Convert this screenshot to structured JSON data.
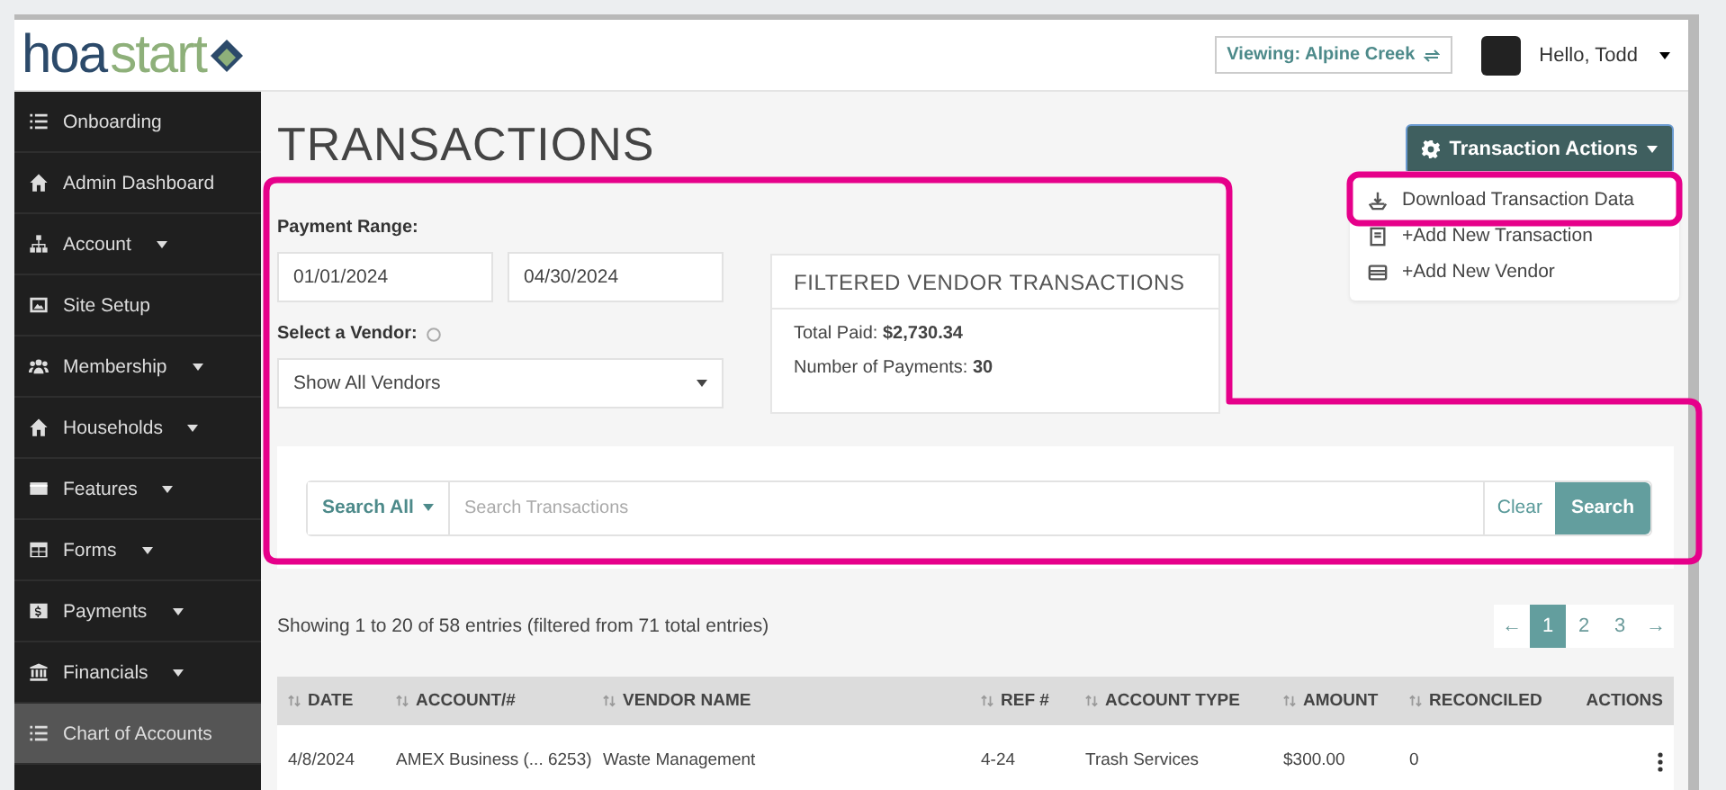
{
  "header": {
    "logo": [
      "hoa",
      "start"
    ],
    "viewing": "Viewing: Alpine Creek",
    "greeting": "Hello, Todd"
  },
  "sidebar": {
    "items": [
      {
        "label": "Onboarding",
        "has_menu": false,
        "selected": false
      },
      {
        "label": "Admin Dashboard",
        "has_menu": false,
        "selected": false
      },
      {
        "label": "Account",
        "has_menu": true,
        "selected": false
      },
      {
        "label": "Site Setup",
        "has_menu": false,
        "selected": false
      },
      {
        "label": "Membership",
        "has_menu": true,
        "selected": false
      },
      {
        "label": "Households",
        "has_menu": true,
        "selected": false
      },
      {
        "label": "Features",
        "has_menu": true,
        "selected": false
      },
      {
        "label": "Forms",
        "has_menu": true,
        "selected": false
      },
      {
        "label": "Payments",
        "has_menu": true,
        "selected": false
      },
      {
        "label": "Financials",
        "has_menu": true,
        "selected": false
      },
      {
        "label": "Chart of Accounts",
        "has_menu": false,
        "selected": true
      }
    ]
  },
  "page_title": "TRANSACTIONS",
  "actions_button": "Transaction Actions",
  "actions_menu": [
    {
      "label": "Download Transaction Data",
      "highlighted": true
    },
    {
      "label": "+Add New Transaction",
      "highlighted": false
    },
    {
      "label": "+Add New Vendor",
      "highlighted": false
    }
  ],
  "filters": {
    "range_label": "Payment Range:",
    "start_date": "01/01/2024",
    "end_date": "04/30/2024",
    "vendor_label": "Select a Vendor:",
    "vendor_value": "Show All Vendors",
    "highlighted": true
  },
  "summary": {
    "title": "FILTERED VENDOR TRANSACTIONS",
    "lines": [
      "Total Paid: **$2,730.34**",
      "Number of Payments: **30**"
    ]
  },
  "search": {
    "scope": "Search All",
    "placeholder": "Search Transactions",
    "clear": "Clear",
    "submit": "Search"
  },
  "entries_info": "Showing 1 to 20 of 58 entries (filtered from 71 total entries)",
  "pagination": [
    {
      "label": "←",
      "selected": false
    },
    {
      "label": "1",
      "selected": true
    },
    {
      "label": "2",
      "selected": false
    },
    {
      "label": "3",
      "selected": false
    },
    {
      "label": "→",
      "selected": false
    }
  ],
  "table": {
    "columns": [
      "DATE",
      "ACCOUNT/#",
      "VENDOR NAME",
      "REF #",
      "ACCOUNT TYPE",
      "AMOUNT",
      "RECONCILED",
      "ACTIONS"
    ],
    "rows": [
      [
        "4/8/2024",
        "AMEX Business (... 6253)",
        "Waste Management",
        "4-24",
        "Trash Services",
        "$300.00",
        "0"
      ]
    ]
  }
}
